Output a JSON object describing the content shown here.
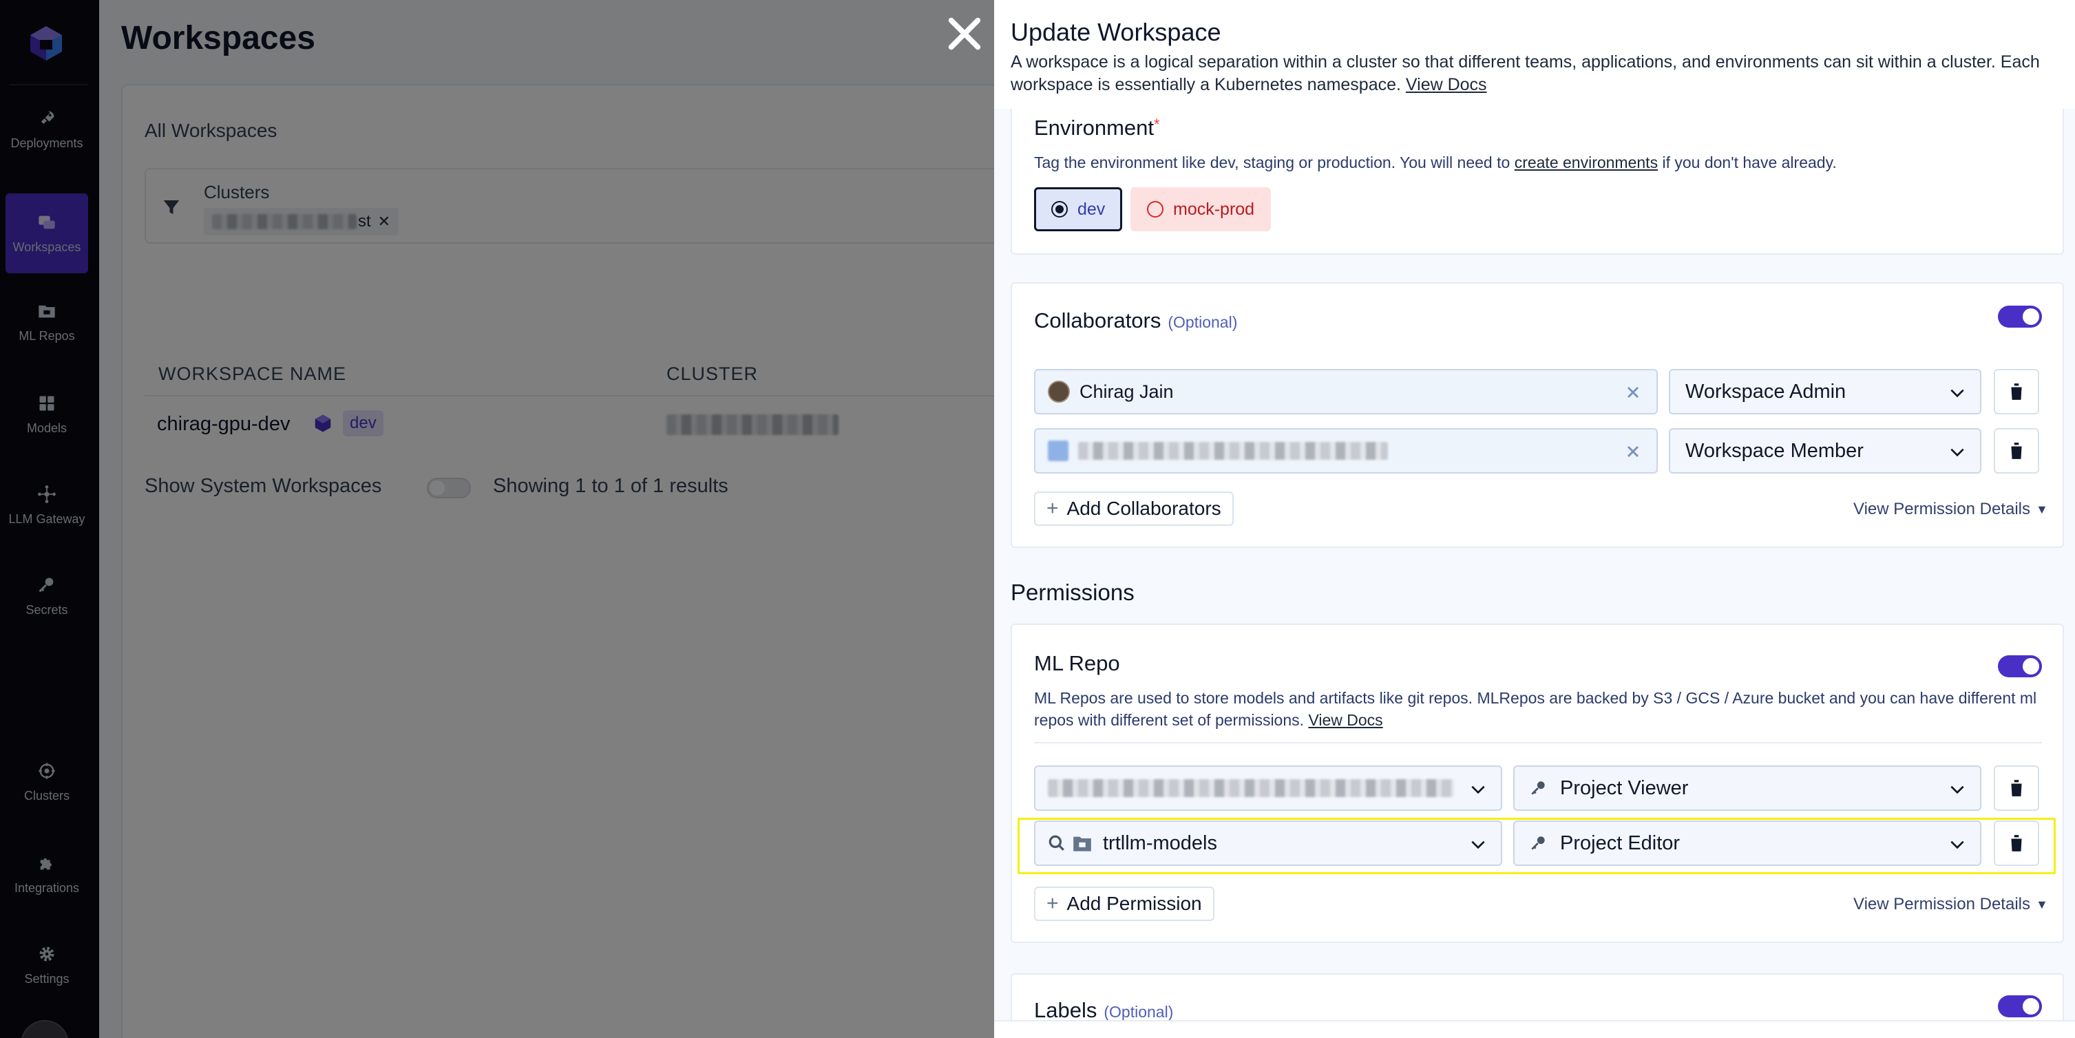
{
  "sidebar": {
    "items": [
      {
        "label": "Deployments",
        "icon": "rocket-icon"
      },
      {
        "label": "Workspaces",
        "icon": "workspaces-icon",
        "active": true
      },
      {
        "label": "ML Repos",
        "icon": "folder-icon"
      },
      {
        "label": "Models",
        "icon": "grid-icon"
      },
      {
        "label": "LLM Gateway",
        "icon": "network-icon"
      },
      {
        "label": "Secrets",
        "icon": "key-icon"
      },
      {
        "label": "Clusters",
        "icon": "clusters-icon"
      },
      {
        "label": "Integrations",
        "icon": "puzzle-icon"
      },
      {
        "label": "Settings",
        "icon": "gear-icon"
      }
    ]
  },
  "page": {
    "title": "Workspaces",
    "card_title": "All Workspaces",
    "filter_label": "Clusters",
    "chip_suffix": "st",
    "columns": [
      "WORKSPACE NAME",
      "CLUSTER"
    ],
    "rows": [
      {
        "name": "chirag-gpu-dev",
        "tag": "dev"
      }
    ],
    "show_system": "Show System Workspaces",
    "showing": "Showing 1 to 1 of 1 results"
  },
  "drawer": {
    "title": "Update Workspace",
    "desc": "A workspace is a logical separation within a cluster so that different teams, applications, and environments can sit within a cluster. Each workspace is essentially a Kubernetes namespace.",
    "docs_link": "View Docs",
    "environment": {
      "title": "Environment",
      "required": "*",
      "desc_prefix": "Tag the environment like dev, staging or production. You will need to",
      "desc_link": "create environments",
      "desc_suffix": "if you don't have already.",
      "options": [
        {
          "label": "dev",
          "selected": true
        },
        {
          "label": "mock-prod",
          "selected": false
        }
      ]
    },
    "collaborators": {
      "title": "Collaborators",
      "optional": "(Optional)",
      "rows": [
        {
          "name": "Chirag Jain",
          "role": "Workspace Admin"
        },
        {
          "name": "",
          "role": "Workspace Member"
        }
      ],
      "add_label": "Add Collaborators",
      "view_details": "View Permission Details"
    },
    "permissions_title": "Permissions",
    "ml_repo": {
      "title": "ML Repo",
      "desc_prefix": "ML Repos are used to store models and artifacts like git repos. MLRepos are backed by S3 / GCS / Azure bucket and you can have different ml repos with different set of permissions.",
      "docs_link": "View Docs",
      "rows": [
        {
          "repo": "",
          "role": "Project Viewer"
        },
        {
          "repo": "trtllm-models",
          "role": "Project Editor"
        }
      ],
      "add_label": "Add Permission",
      "view_details": "View Permission Details"
    },
    "labels": {
      "title": "Labels",
      "optional": "(Optional)"
    }
  },
  "colors": {
    "accent": "#4a2fc7",
    "highlight": "#f5f014",
    "sidebar": "#0b0b12"
  }
}
